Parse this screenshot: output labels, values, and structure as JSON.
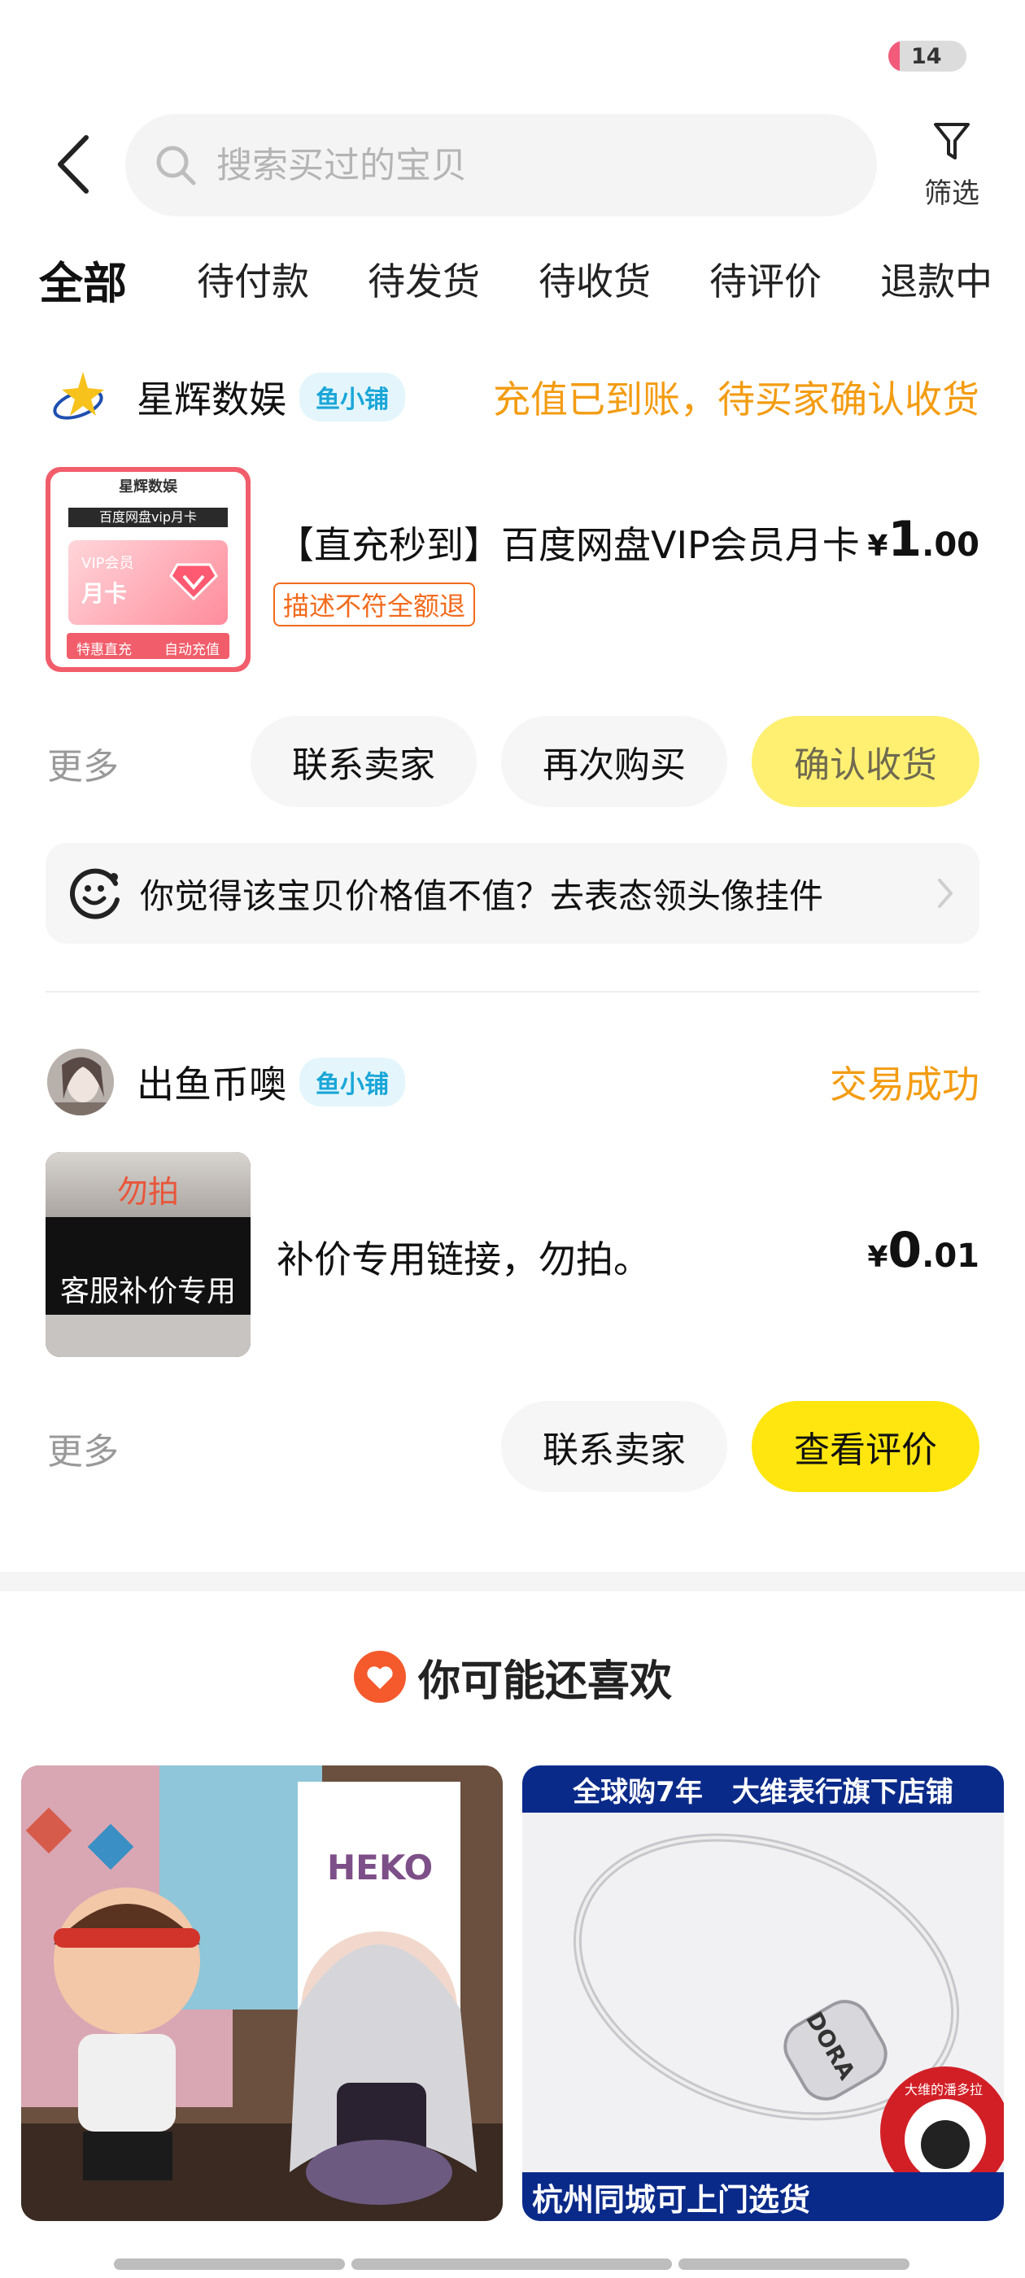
{
  "status_bar": {
    "badge_count": "14"
  },
  "header": {
    "search_placeholder": "搜索买过的宝贝",
    "filter_label": "筛选",
    "icons": {
      "back": "chevron-left-icon",
      "search": "search-icon",
      "filter": "filter-icon"
    }
  },
  "tabs": [
    {
      "label": "全部",
      "active": true
    },
    {
      "label": "待付款"
    },
    {
      "label": "待发货"
    },
    {
      "label": "待收货"
    },
    {
      "label": "待评价"
    },
    {
      "label": "退款中"
    }
  ],
  "orders": [
    {
      "shop_name": "星辉数娱",
      "shop_badge": "鱼小铺",
      "status": "充值已到账，待买家确认收货",
      "thumb": {
        "brand": "星辉数娱",
        "banner": "百度网盘vip月卡",
        "vip_label": "VIP会员",
        "card_label": "月卡",
        "footer_left": "特惠直充",
        "footer_right": "自动充值"
      },
      "title": "【直充秒到】百度网盘VIP会员月卡",
      "tag": "描述不符全额退",
      "price": {
        "currency": "¥",
        "integer": "1",
        "decimal": ".00"
      },
      "more": "更多",
      "buttons": [
        "联系卖家",
        "再次购买",
        "确认收货"
      ]
    },
    {
      "shop_name": "出鱼币噢",
      "shop_badge": "鱼小铺",
      "status": "交易成功",
      "thumb": {
        "top_text": "勿拍",
        "bottom_text": "客服补价专用"
      },
      "title": "补价专用链接，勿拍。",
      "price": {
        "currency": "¥",
        "integer": "0",
        "decimal": ".01"
      },
      "more": "更多",
      "buttons": [
        "联系卖家",
        "查看评价"
      ]
    }
  ],
  "feedback": {
    "text": "你觉得该宝贝价格值不值？去表态领头像挂件",
    "icon": "smile-face-icon"
  },
  "recommend": {
    "heading": "你可能还喜欢",
    "icon": "heart-icon",
    "cards": [
      {
        "kind": "toy-figure-photo",
        "box_text": "HEKO"
      },
      {
        "banner_left": "全球购7年",
        "banner_right": "大维表行旗下店铺",
        "bottom_text": "杭州同城可上门选货",
        "bead_text": "DORA",
        "seal_text": "大维的潘多拉"
      }
    ]
  },
  "colors": {
    "accent_yellow": "#ffe60f",
    "status_orange": "#f39c12",
    "badge_blue": "#1aa6d8",
    "tag_orange": "#f26b1c"
  }
}
